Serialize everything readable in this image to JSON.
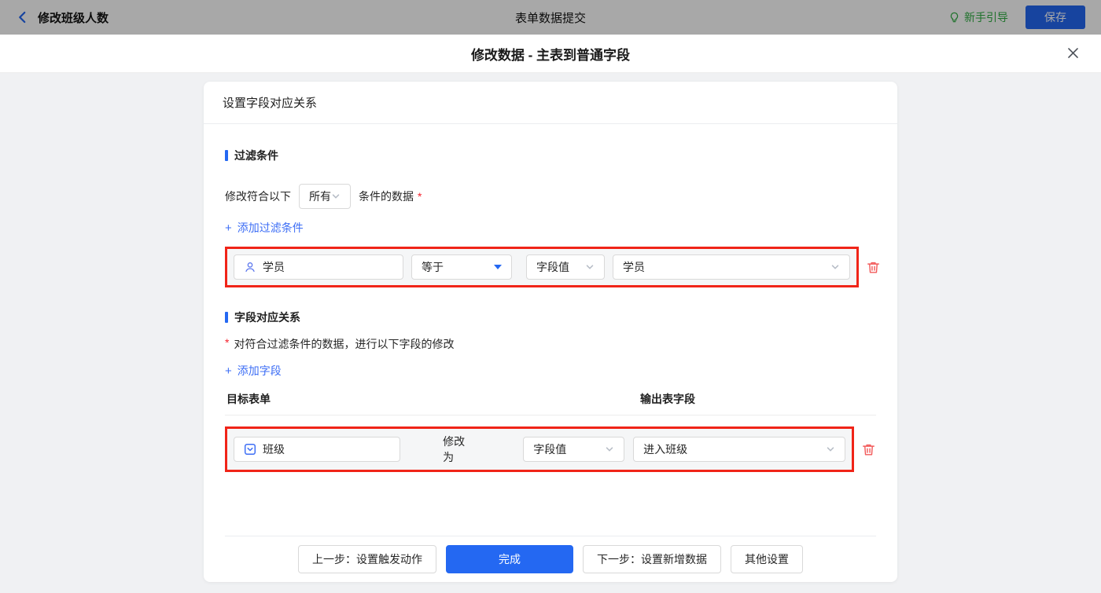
{
  "topbar": {
    "back_label": "修改班级人数",
    "title": "表单数据提交",
    "guide_label": "新手引导",
    "save_label": "保存"
  },
  "modal": {
    "title": "修改数据 - 主表到普通字段"
  },
  "card": {
    "header": "设置字段对应关系",
    "filter": {
      "title": "过滤条件",
      "match_prefix": "修改符合以下",
      "match_value": "所有",
      "match_suffix": "条件的数据",
      "required": "*",
      "add_plus": "+",
      "add_label": "添加过滤条件",
      "row": {
        "field": "学员",
        "operator": "等于",
        "value_type": "字段值",
        "value": "学员"
      }
    },
    "mapping": {
      "title": "字段对应关系",
      "required": "*",
      "description": "对符合过滤条件的数据，进行以下字段的修改",
      "add_plus": "+",
      "add_label": "添加字段",
      "col_target": "目标表单",
      "col_output": "输出表字段",
      "row": {
        "field": "班级",
        "action": "修改为",
        "value_type": "字段值",
        "value": "进入班级"
      }
    },
    "footer": {
      "prev": "上一步：设置触发动作",
      "done": "完成",
      "next": "下一步：设置新增数据",
      "other": "其他设置"
    }
  },
  "colors": {
    "accent_blue": "#2468f2",
    "link_blue": "#3d6ef5",
    "annotation_red": "#f02418",
    "danger_red": "#f25a5a",
    "guide_green": "#2fae43",
    "row_bg": "#f5f6f7"
  }
}
